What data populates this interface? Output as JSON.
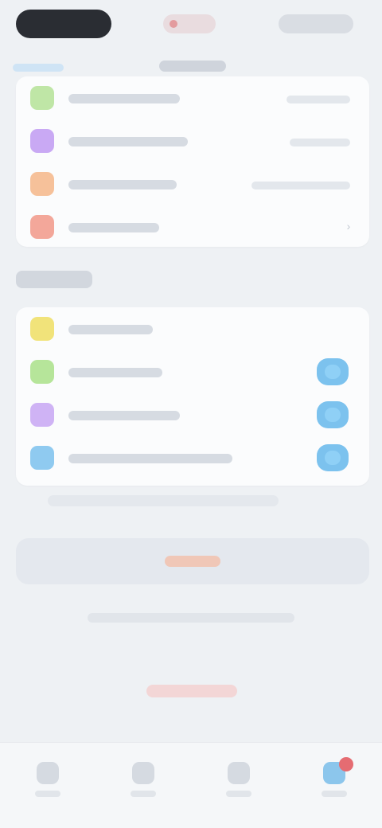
{
  "colors": {
    "background": "#eef1f4",
    "card": "#fbfcfd",
    "toggle_on": "#7cc2ee",
    "badge": "#e56c72",
    "danger": "#f0c7b7"
  },
  "header": {
    "left_pill": "",
    "center_pill": "",
    "right_pill": ""
  },
  "section_top": {
    "items": [
      {
        "icon": "green-square-icon",
        "icon_color": "#bfe6a6",
        "label": "",
        "value": ""
      },
      {
        "icon": "purple-square-icon",
        "icon_color": "#c9a9f4",
        "label": "",
        "value": ""
      },
      {
        "icon": "orange-square-icon",
        "icon_color": "#f6c19a",
        "label": "",
        "value": ""
      },
      {
        "icon": "red-square-icon",
        "icon_color": "#f3a79a",
        "label": "",
        "value": ""
      }
    ]
  },
  "section_second": {
    "title": "",
    "items": [
      {
        "icon": "yellow-square-icon",
        "icon_color": "#f1e37a",
        "label": "",
        "toggle": null
      },
      {
        "icon": "green-square-icon",
        "icon_color": "#b6e59a",
        "label": "",
        "toggle": true
      },
      {
        "icon": "purple-square-icon",
        "icon_color": "#cfb3f5",
        "label": "",
        "toggle": true
      },
      {
        "icon": "blue-square-icon",
        "icon_color": "#8fcaf0",
        "label": "",
        "toggle": true
      }
    ],
    "footnote": ""
  },
  "actions": {
    "primary_label": "",
    "helper_text": "",
    "danger_label": ""
  },
  "tabbar": {
    "tabs": [
      {
        "icon": "tab-icon-1",
        "label": ""
      },
      {
        "icon": "tab-icon-2",
        "label": ""
      },
      {
        "icon": "tab-icon-3",
        "label": ""
      },
      {
        "icon": "tab-icon-4",
        "label": "",
        "active": true
      }
    ]
  }
}
